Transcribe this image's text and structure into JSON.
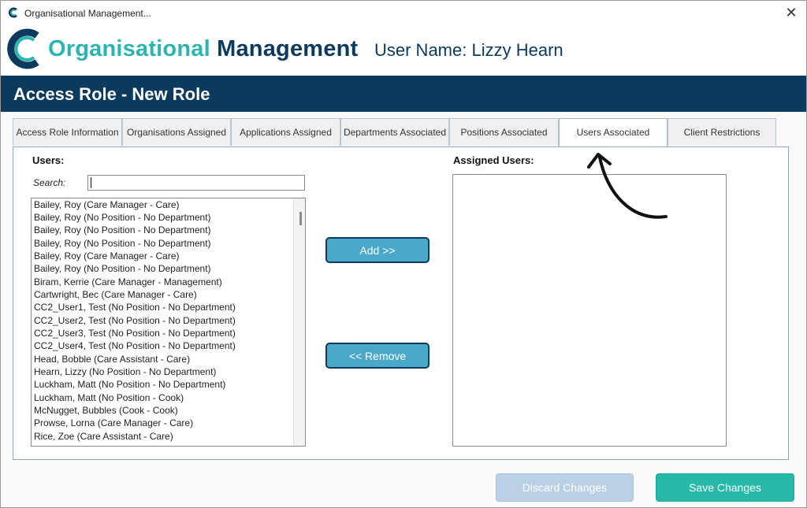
{
  "window": {
    "title": "Organisational Management...",
    "close_glyph": "✕"
  },
  "header": {
    "logo_text_part1": "Organisational ",
    "logo_text_part2": "Management",
    "user_name": "User Name: Lizzy Hearn"
  },
  "banner": {
    "title": "Access Role - New Role"
  },
  "tabs": [
    {
      "label": "Access Role Information"
    },
    {
      "label": "Organisations Assigned"
    },
    {
      "label": "Applications Assigned"
    },
    {
      "label": "Departments Associated"
    },
    {
      "label": "Positions Associated"
    },
    {
      "label": "Users Associated"
    },
    {
      "label": "Client Restrictions"
    }
  ],
  "active_tab": "Users Associated",
  "users_panel": {
    "heading": "Users:",
    "search_label": "Search:",
    "search_value": "",
    "items": [
      "Bailey, Roy (Care Manager - Care)",
      "Bailey, Roy (No Position - No Department)",
      "Bailey, Roy (No Position - No Department)",
      "Bailey, Roy (No Position - No Department)",
      "Bailey, Roy (Care Manager - Care)",
      "Bailey, Roy (No Position - No Department)",
      "Biram, Kerrie (Care Manager - Management)",
      "Cartwright, Bec (Care Manager - Care)",
      "CC2_User1, Test (No Position - No Department)",
      "CC2_User2, Test (No Position - No Department)",
      "CC2_User3, Test (No Position - No Department)",
      "CC2_User4, Test (No Position - No Department)",
      "Head, Bobble (Care Assistant - Care)",
      "Hearn, Lizzy (No Position - No Department)",
      "Luckham, Matt (No Position - No Department)",
      "Luckham, Matt (No Position - Cook)",
      "McNugget, Bubbles (Cook - Cook)",
      "Prowse, Lorna (Care Manager - Care)",
      "Rice, Zoe (Care Assistant - Care)"
    ]
  },
  "actions": {
    "add_label": "Add  >>",
    "remove_label": "<< Remove"
  },
  "assigned_panel": {
    "heading": "Assigned Users:",
    "items": []
  },
  "footer": {
    "discard_label": "Discard Changes",
    "save_label": "Save Changes"
  },
  "colors": {
    "brand_navy": "#0b3a5c",
    "brand_teal": "#2bb5b0",
    "button_blue": "#4aa9c8",
    "save_teal": "#27b8a8",
    "discard_disabled": "#b9d0e6"
  }
}
